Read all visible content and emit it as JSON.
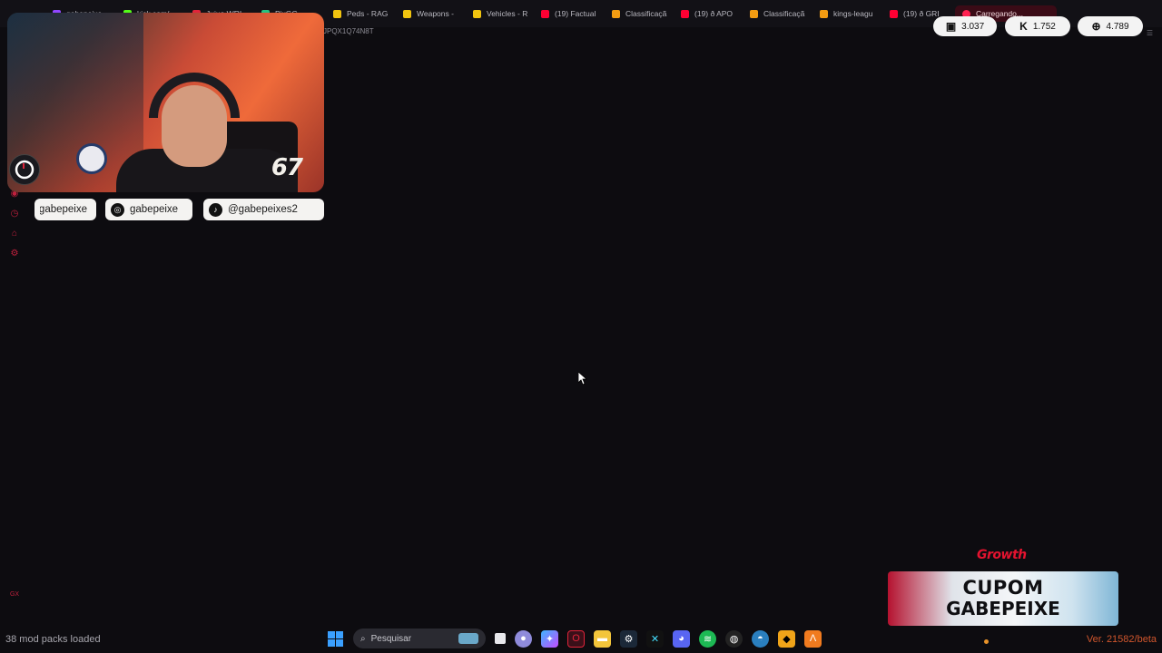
{
  "browser": {
    "tabs": [
      {
        "label": "gabepeixe",
        "color": "#9146ff"
      },
      {
        "label": "kick.com/",
        "color": "#53fc18"
      },
      {
        "label": "Jujuo WRI",
        "color": "#e0243a"
      },
      {
        "label": "PixGG",
        "color": "#26c281"
      },
      {
        "label": "Peds - RAG",
        "color": "#f1c40f"
      },
      {
        "label": "Weapons -",
        "color": "#f1c40f"
      },
      {
        "label": "Vehicles - R",
        "color": "#f1c40f"
      },
      {
        "label": "(19) Factual",
        "color": "#ff0033"
      },
      {
        "label": "Classificaçã",
        "color": "#f39c12"
      },
      {
        "label": "(19) ð APO",
        "color": "#ff0033"
      },
      {
        "label": "Classificaçã",
        "color": "#f39c12"
      },
      {
        "label": "kings-leagu",
        "color": "#f39c12"
      },
      {
        "label": "(19) ð GRI",
        "color": "#ff0033"
      },
      {
        "label": "Carregando...",
        "color": "#ff2050"
      }
    ],
    "url": "JPQX1Q74N8T"
  },
  "stats": {
    "twitch_viewers": "3.037",
    "kick_viewers": "1.752",
    "total_viewers": "4.789"
  },
  "webcam": {
    "counter": "67"
  },
  "socials": [
    {
      "handle": "gabepeixe",
      "icon": "twitch-icon"
    },
    {
      "handle": "gabepeixe",
      "icon": "instagram-icon"
    },
    {
      "handle": "@gabepeixes2",
      "icon": "tiktok-icon"
    }
  ],
  "promo": {
    "brand": "Growth",
    "line1": "CUPOM",
    "line2": "GABEPEIXE"
  },
  "status_bar": {
    "left": "38 mod packs loaded",
    "right": "Ver. 21582/beta"
  },
  "taskbar": {
    "search_placeholder": "Pesquisar"
  },
  "colors": {
    "accent": "#c0203d",
    "background": "#0d0c10"
  }
}
